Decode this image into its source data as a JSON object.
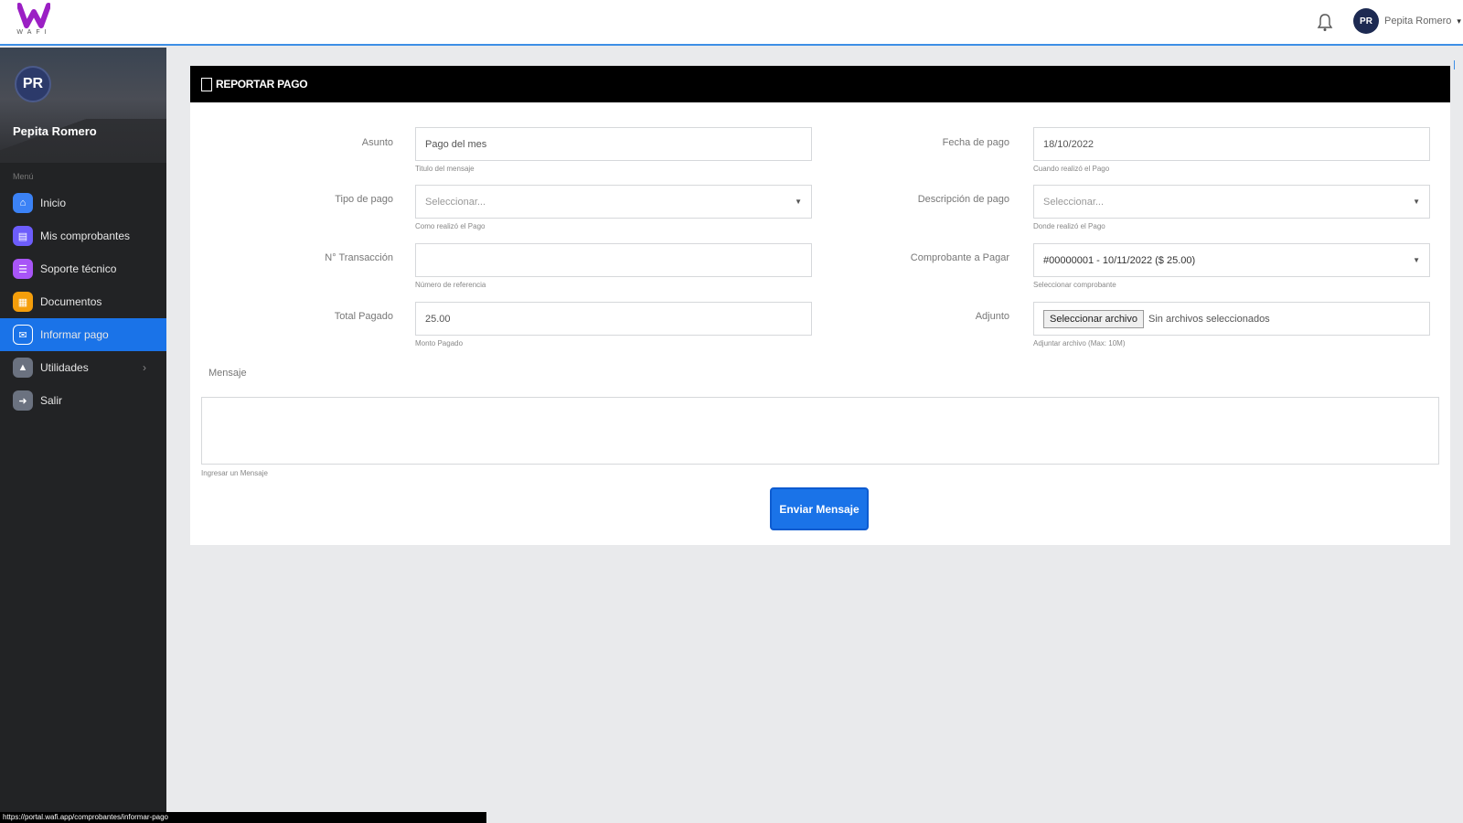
{
  "topbar": {
    "logo_text": "WAFI",
    "username": "Pepita Romero",
    "avatar_initials": "PR"
  },
  "sidebar": {
    "avatar_initials": "PR",
    "user_name": "Pepita Romero",
    "menu_label": "Menú",
    "items": [
      {
        "label": "Inicio",
        "icon": "home-icon",
        "color": "#3b82f6"
      },
      {
        "label": "Mis comprobantes",
        "icon": "document-icon",
        "color": "#6d5dfc"
      },
      {
        "label": "Soporte técnico",
        "icon": "support-icon",
        "color": "#a855f7"
      },
      {
        "label": "Documentos",
        "icon": "folder-icon",
        "color": "#f59e0b"
      },
      {
        "label": "Informar pago",
        "icon": "payment-icon",
        "color": "#1a73e8"
      },
      {
        "label": "Utilidades",
        "icon": "tools-icon",
        "color": "#6b7280"
      },
      {
        "label": "Salir",
        "icon": "logout-icon",
        "color": "#6b7280"
      }
    ]
  },
  "card": {
    "title": "Reportar pago"
  },
  "form": {
    "asunto": {
      "label": "Asunto",
      "value": "Pago del mes",
      "help": "Titulo del mensaje"
    },
    "tipo_pago": {
      "label": "Tipo de pago",
      "value": "Seleccionar...",
      "help": "Como realizó el Pago"
    },
    "transaccion": {
      "label": "N° Transacción",
      "value": "",
      "help": "Número de referencia"
    },
    "total": {
      "label": "Total Pagado",
      "value": "25.00",
      "help": "Monto Pagado"
    },
    "fecha": {
      "label": "Fecha de pago",
      "value": "18/10/2022",
      "help": "Cuando realizó el Pago"
    },
    "descripcion": {
      "label": "Descripción de pago",
      "value": "Seleccionar...",
      "help": "Donde realizó el Pago"
    },
    "comprobante": {
      "label": "Comprobante a Pagar",
      "value": "#00000001 - 10/11/2022 ($ 25.00)",
      "help": "Seleccionar comprobante"
    },
    "adjunto": {
      "label": "Adjunto",
      "button": "Seleccionar archivo",
      "status": "Sin archivos seleccionados",
      "help": "Adjuntar archivo (Max: 10M)"
    },
    "mensaje": {
      "label": "Mensaje",
      "help": "Ingresar un Mensaje"
    },
    "submit": "Enviar Mensaje"
  },
  "statusbar": "https://portal.wafi.app/comprobantes/informar-pago"
}
